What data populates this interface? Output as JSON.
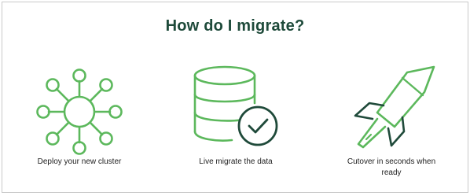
{
  "heading": "How do I migrate?",
  "steps": [
    {
      "icon": "cluster-icon",
      "caption": "Deploy your new cluster"
    },
    {
      "icon": "database-check-icon",
      "caption": "Live migrate the data"
    },
    {
      "icon": "rocket-icon",
      "caption": "Cutover in seconds when ready"
    }
  ],
  "colors": {
    "heading": "#1e4a3a",
    "icon_green": "#5cb85c",
    "icon_dark": "#1f4a3a"
  }
}
